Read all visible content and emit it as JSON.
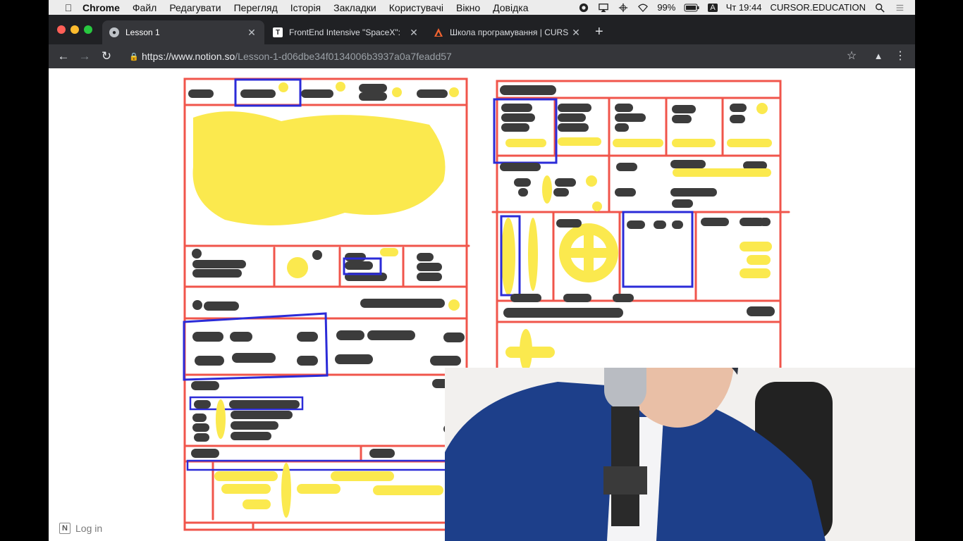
{
  "menubar": {
    "app_name": "Chrome",
    "items": [
      "Файл",
      "Редагувати",
      "Перегляд",
      "Історія",
      "Закладки",
      "Користувачі",
      "Вікно",
      "Довідка"
    ],
    "battery": "99%",
    "input_source": "A",
    "clock": "Чт 19:44",
    "user": "CURSOR.EDUCATION"
  },
  "tabs": [
    {
      "title": "Lesson 1",
      "favicon": "alien-icon",
      "active": true
    },
    {
      "title": "FrontEnd Intensive \"SpaceX\": ",
      "favicon": "T",
      "active": false
    },
    {
      "title": "Школа програмування | CURS",
      "favicon": "cursor-logo-icon",
      "active": false
    }
  ],
  "toolbar": {
    "url_host": "https://www.notion.so",
    "url_path": "/Lesson-1-d06dbe34f0134006b3937a0a7feadd57"
  },
  "page": {
    "login_label": "Log in",
    "login_logo": "N"
  },
  "colors": {
    "sketch_red": "#f0554b",
    "sketch_blue": "#2b2bd8",
    "sketch_yellow": "#fbe94e",
    "sketch_dark": "#3c3c3c"
  }
}
